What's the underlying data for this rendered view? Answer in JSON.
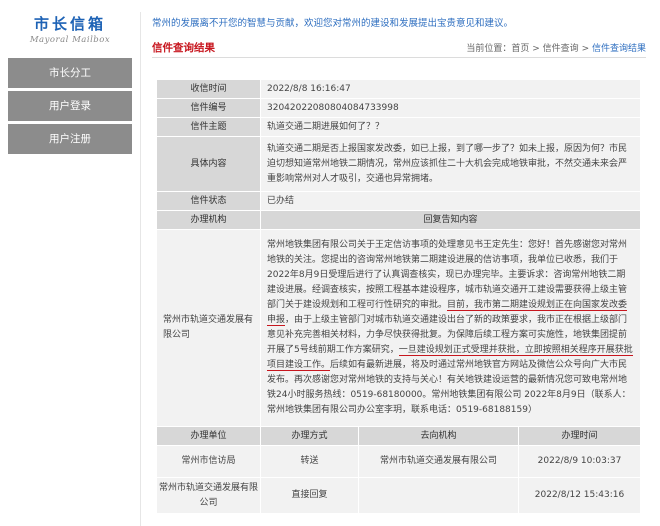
{
  "logo": {
    "cn": "市长信箱",
    "en": "Mayoral Mailbox"
  },
  "nav": [
    {
      "label": "市长分工"
    },
    {
      "label": "用户登录"
    },
    {
      "label": "用户注册"
    }
  ],
  "notice": "常州的发展离不开您的智慧与贡献，欢迎您对常州的建设和发展提出宝贵意见和建议。",
  "page_title": "信件查询结果",
  "breadcrumb": {
    "prefix": "当前位置：",
    "items": [
      "首页",
      "信件查询",
      "信件查询结果"
    ],
    "sep": ">"
  },
  "letter": {
    "labels": {
      "time": "收信时间",
      "id": "信件编号",
      "subject": "信件主题",
      "content": "具体内容",
      "status": "信件状态",
      "org": "办理机构",
      "reply_head": "回复告知内容"
    },
    "time": "2022/8/8 16:16:47",
    "id": "32042022080804084733998",
    "subject": "轨道交通二期进展如何了？？",
    "content": "轨道交通二期是否上报国家发改委，如已上报，到了哪一步了？如未上报，原因为何？市民迫切想知道常州地铁二期情况，常州应该抓住二十大机会完成地铁审批，不然交通未来会严重影响常州对人才吸引，交通也异常拥堵。",
    "status": "已办结",
    "org": "常州市轨道交通发展有限公司",
    "reply": {
      "p1": "常州地铁集团有限公司关于王定信访事项的处理意见书王定先生：您好！首先感谢您对常州地铁的关注。您提出的咨询常州地铁第二期建设进展的信访事项，我单位已收悉，我们于2022年8月9日受理后进行了认真调查核实，现已办理完毕。主要诉求：咨询常州地铁二期建设进展。经调查核实，按照工程基本建设程序，城市轨道交通开工建设需要获得上级主管部门关于建设规划和工程可行性研究的审批。",
      "hl1": "目前，我市第二期建设规划正在向国家发改委申报",
      "p2": "，由于上级主管部门对城市轨道交通建设出台了新的政策要求，我市正在根据上级部门意见补充完善相关材料，力争尽快获得批复。为保障后续工程方案可实施性，地铁集团提前开展了5号线前期工作方案研究，",
      "hl2": "一旦建设规划正式受理并获批，立即按照相关程序开展获批项目建设工作。",
      "p3": "后续如有最新进展，将及时通过常州地铁官方网站及微信公众号向广大市民发布。再次感谢您对常州地铁的支持与关心！有关地铁建设运营的最新情况您可致电常州地铁24小时服务热线：0519-68180000。常州地铁集团有限公司 2022年8月9日（联系人：常州地铁集团有限公司办公室李玥，联系电话：0519-68188159）"
    }
  },
  "process": {
    "headers": [
      "办理单位",
      "办理方式",
      "去向机构",
      "办理时间"
    ],
    "rows": [
      [
        "常州市信访局",
        "转送",
        "常州市轨道交通发展有限公司",
        "2022/8/9 10:03:37"
      ],
      [
        "常州市轨道交通发展有限公司",
        "直接回复",
        "",
        "2022/8/12 15:43:16"
      ]
    ]
  },
  "colors": {
    "accent_blue": "#1d62b5",
    "title_red": "#c7161e",
    "nav_gray": "#8c8c8c",
    "label_gray": "#d7d7d7",
    "cell_gray": "#f2f2f2"
  }
}
